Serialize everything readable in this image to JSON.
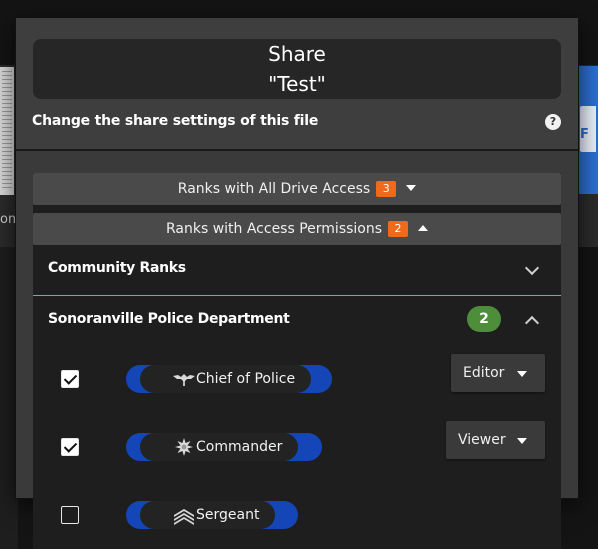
{
  "background": {
    "left_text": "om"
  },
  "modal": {
    "title_line1": "Share",
    "title_line2": "\"Test\"",
    "subtitle": "Change the share settings of this file",
    "help_icon_glyph": "?"
  },
  "sections": {
    "all_drive": {
      "label": "Ranks with All Drive Access",
      "count": "3",
      "state": "collapsed"
    },
    "access_permissions": {
      "label": "Ranks with Access Permissions",
      "count": "2",
      "state": "expanded"
    },
    "community": {
      "label": "Community Ranks",
      "state": "collapsed"
    },
    "police": {
      "label": "Sonoranville Police Department",
      "count": "2",
      "state": "expanded"
    }
  },
  "ranks": [
    {
      "name": "Chief of Police",
      "checked": true,
      "role": "Editor",
      "insignia": "eagle-insignia-icon"
    },
    {
      "name": "Commander",
      "checked": true,
      "role": "Viewer",
      "insignia": "star-cluster-insignia-icon"
    },
    {
      "name": "Sergeant",
      "checked": false,
      "role": "",
      "insignia": "chevron-stripes-insignia-icon"
    }
  ],
  "colors": {
    "accent_orange": "#f06a1c",
    "accent_green": "#4e8e3b",
    "pill_blue": "#1446b7",
    "divider_blue": "#6fa5c4"
  }
}
